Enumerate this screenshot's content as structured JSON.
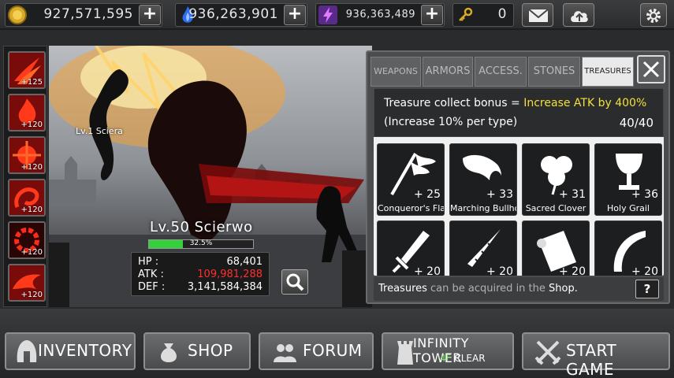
{
  "currencies": {
    "gold": "927,571,595",
    "gems": "936,263,901",
    "energy": "936,363,489",
    "keys": "0"
  },
  "skills": [
    {
      "level": "+125",
      "icon": "fire-claw-icon"
    },
    {
      "level": "+120",
      "icon": "fire-flame-icon"
    },
    {
      "level": "+120",
      "icon": "fire-burst-icon"
    },
    {
      "level": "+120",
      "icon": "fire-swirl-icon"
    },
    {
      "level": "+120",
      "icon": "fire-ring-icon"
    },
    {
      "level": "+120",
      "icon": "fire-dragon-icon"
    }
  ],
  "scene": {
    "pet_label": "Lv.1 Sciera",
    "hero_name": "Lv.50 Scierwo",
    "hp_percent_text": "32.5%",
    "hp_fraction": 0.325,
    "stats": [
      {
        "key": "HP :",
        "value": "68,401"
      },
      {
        "key": "ATK :",
        "value": "109,981,288"
      },
      {
        "key": "DEF :",
        "value": "3,141,584,384"
      }
    ]
  },
  "panel": {
    "tabs": [
      "WEAPONS",
      "ARMORS",
      "ACCESS.",
      "STONES",
      "TREASURES"
    ],
    "active_tab": "TREASURES",
    "bonus_prefix": "Treasure collect bonus = ",
    "bonus_value": "Increase ATK by 400%",
    "bonus_note": "(Increase 10% per type)",
    "collected": "40/40",
    "items": [
      {
        "name": "Conqueror's Flag",
        "count": "+ 25",
        "icon": "flag-icon"
      },
      {
        "name": "Marching Bullhorn",
        "count": "+ 33",
        "icon": "bullhorn-icon"
      },
      {
        "name": "Sacred Clover",
        "count": "+ 31",
        "icon": "clover-icon"
      },
      {
        "name": "Holy Grail",
        "count": "+ 36",
        "icon": "grail-icon"
      },
      {
        "name": "",
        "count": "+ 20",
        "icon": "sword-icon"
      },
      {
        "name": "",
        "count": "+ 20",
        "icon": "drill-icon"
      },
      {
        "name": "",
        "count": "+ 20",
        "icon": "scroll-icon"
      },
      {
        "name": "",
        "count": "+ 20",
        "icon": "horn-icon"
      }
    ],
    "footer_word1": "Treasures",
    "footer_mid": " can be acquired in the ",
    "footer_word2": "Shop",
    "footer_end": ".",
    "help_label": "?"
  },
  "bottom": {
    "inventory": "INVENTORY",
    "shop": "SHOP",
    "forum": "FORUM",
    "tower": "INFINITY TOWER",
    "tower_floor": "4F",
    "tower_status": " CLEAR",
    "start": "START GAME"
  },
  "colors": {
    "accent_yellow": "#f2e03a",
    "atk_red": "#ff3030",
    "hp_green": "#34d13a",
    "clear_green": "#7fe06b"
  }
}
